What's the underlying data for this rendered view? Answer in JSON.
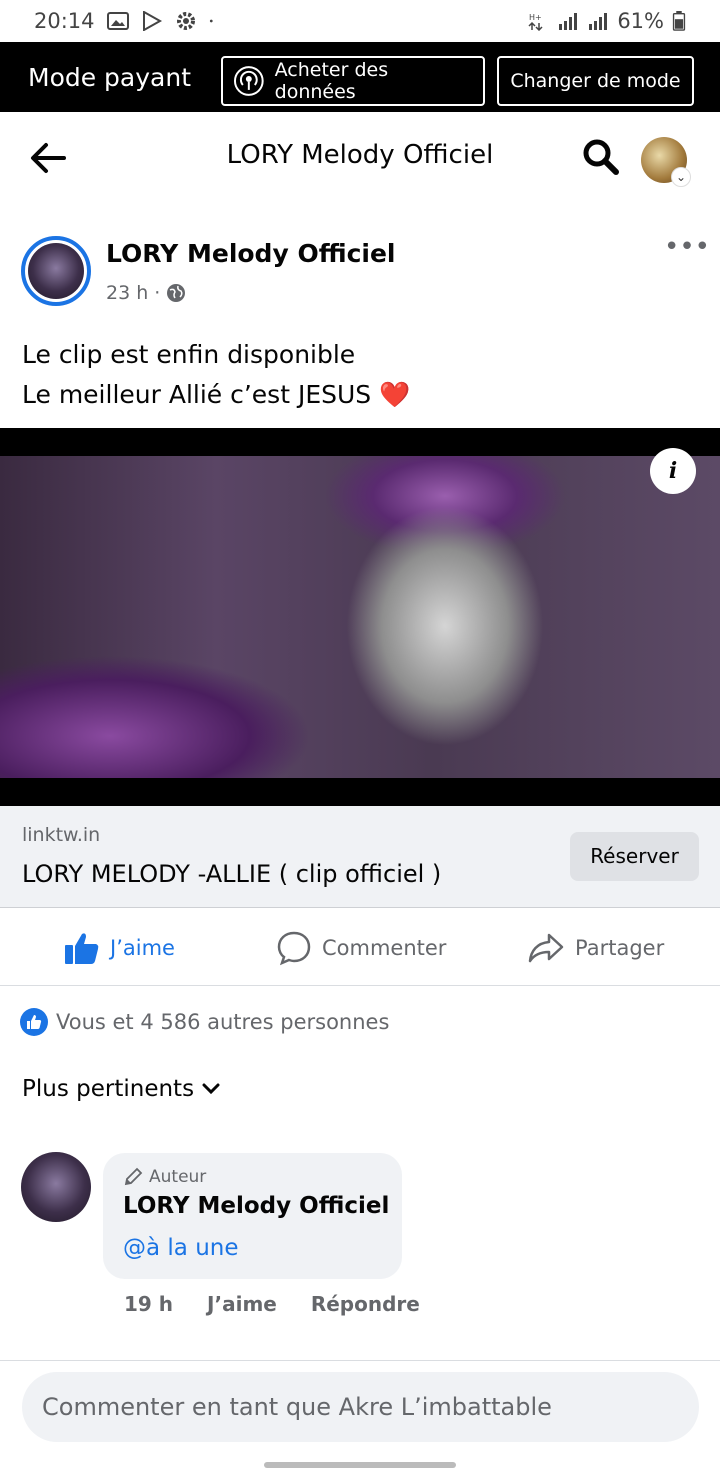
{
  "status_bar": {
    "time": "20:14",
    "battery": "61%",
    "icons": [
      "image-icon",
      "play-store-icon",
      "settings-icon",
      "dot-icon",
      "data-arrows-icon",
      "signal-icon",
      "signal-icon",
      "battery-icon"
    ]
  },
  "mode_bar": {
    "title": "Mode payant",
    "buy_label": "Acheter des données",
    "change_label": "Changer de mode"
  },
  "header": {
    "title": "LORY Melody Officiel"
  },
  "post": {
    "author": "LORY Melody Officiel",
    "time": "23 h",
    "privacy_icon": "globe-icon",
    "text_line1": "Le clip est enfin disponible",
    "text_line2": "Le meilleur Allié c’est JESUS",
    "emoji": "❤️"
  },
  "video": {
    "info_label": "i"
  },
  "link_preview": {
    "domain": "linktw.in",
    "title": "LORY MELODY -ALLIE ( clip officiel )",
    "button_label": "Réserver"
  },
  "actions": {
    "like": "J’aime",
    "comment": "Commenter",
    "share": "Partager"
  },
  "reactions": {
    "text": "Vous et 4 586 autres personnes"
  },
  "sort": {
    "label": "Plus pertinents"
  },
  "comment": {
    "badge": "Auteur",
    "author": "LORY Melody Officiel",
    "text": "@à la une",
    "time": "19 h",
    "like": "J’aime",
    "reply": "Répondre"
  },
  "composer": {
    "placeholder": "Commenter en tant que Akre L’imbattable"
  },
  "colors": {
    "accent": "#1b74e4",
    "secondary_text": "#65676b",
    "bubble_bg": "#f0f2f5"
  }
}
